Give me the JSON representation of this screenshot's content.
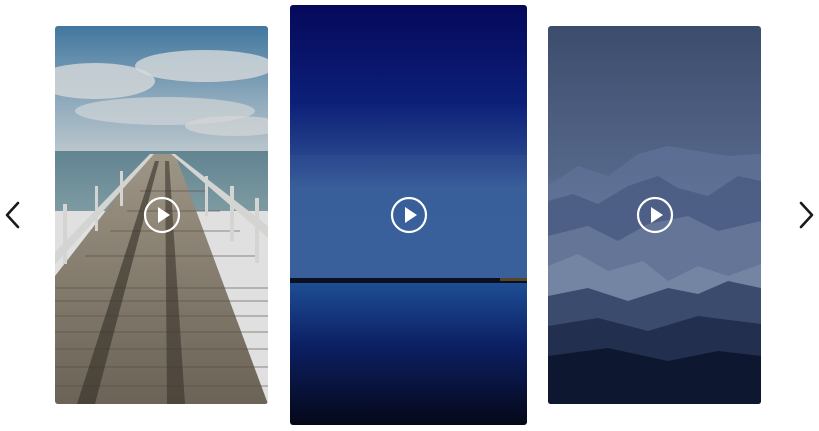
{
  "carousel": {
    "prev_icon": "chevron-left-icon",
    "next_icon": "chevron-right-icon",
    "arrow_color": "#1a1a1a",
    "slides": [
      {
        "id": "pier",
        "icon": "play-icon"
      },
      {
        "id": "sea-horizon",
        "icon": "play-icon"
      },
      {
        "id": "mountains",
        "icon": "play-icon"
      }
    ]
  },
  "colors": {
    "pier_sky": "#7fa4c4",
    "pier_wood": "#8f877b",
    "sea_top": "#050a52",
    "sea_bottom": "#050818",
    "mountain_sky": "#3e4f6e",
    "mountain_dark": "#0e1730",
    "play_icon": "#ffffff"
  }
}
